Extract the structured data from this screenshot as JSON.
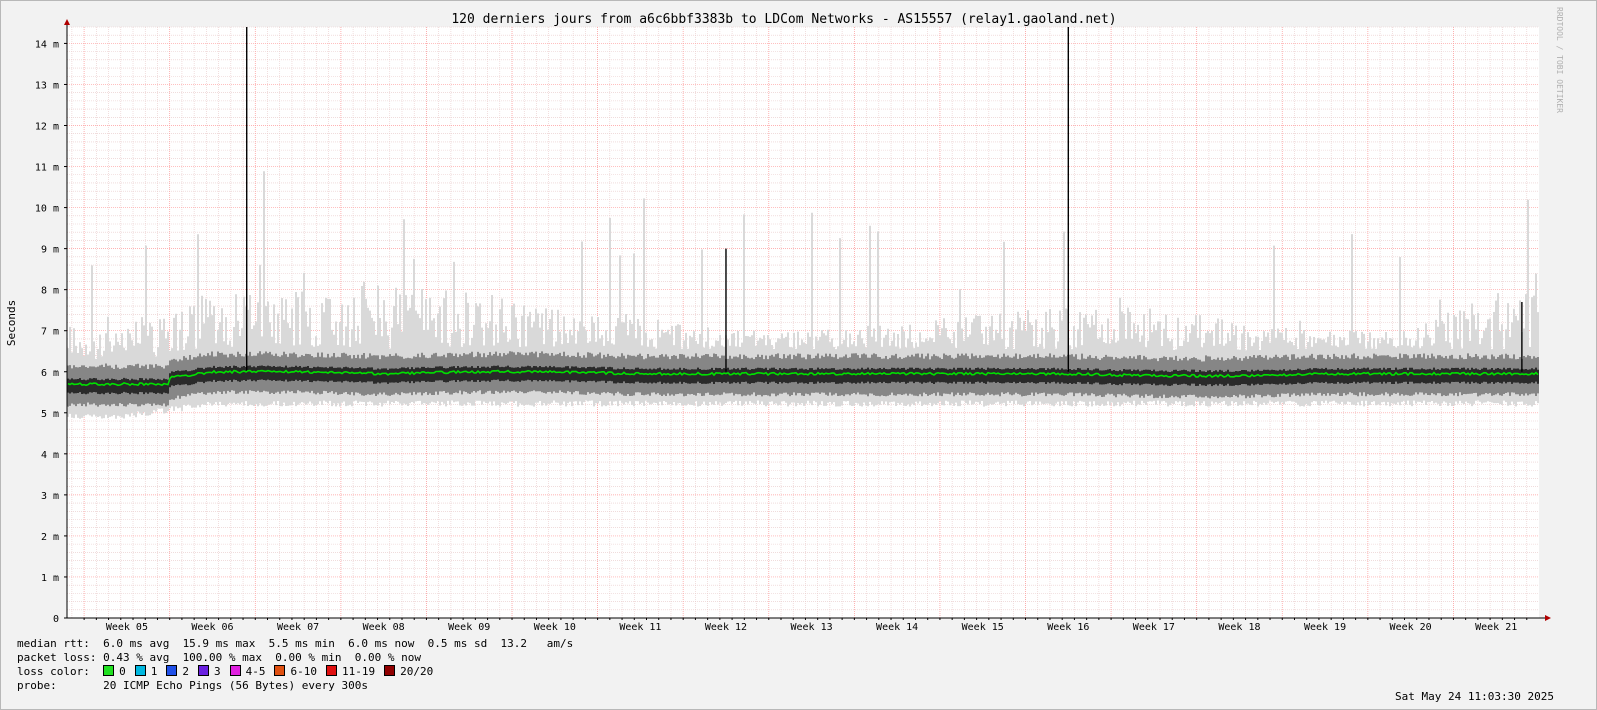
{
  "chart_data": {
    "type": "area",
    "title": "120 derniers jours from a6c6bbf3383b to LDCom Networks - AS15557 (relay1.gaoland.net)",
    "ylabel": "Seconds",
    "watermark": "RRDTOOL / TOBI OETIKER",
    "ylim": [
      0,
      14.4
    ],
    "yticks": [
      {
        "value": 0,
        "label": "0"
      },
      {
        "value": 1,
        "label": "1 m"
      },
      {
        "value": 2,
        "label": "2 m"
      },
      {
        "value": 3,
        "label": "3 m"
      },
      {
        "value": 4,
        "label": "4 m"
      },
      {
        "value": 5,
        "label": "5 m"
      },
      {
        "value": 6,
        "label": "6 m"
      },
      {
        "value": 7,
        "label": "7 m"
      },
      {
        "value": 8,
        "label": "8 m"
      },
      {
        "value": 9,
        "label": "9 m"
      },
      {
        "value": 10,
        "label": "10 m"
      },
      {
        "value": 11,
        "label": "11 m"
      },
      {
        "value": 12,
        "label": "12 m"
      },
      {
        "value": 13,
        "label": "13 m"
      },
      {
        "value": 14,
        "label": "14 m"
      }
    ],
    "categories": [
      "Week 05",
      "Week 06",
      "Week 07",
      "Week 08",
      "Week 09",
      "Week 10",
      "Week 11",
      "Week 12",
      "Week 13",
      "Week 14",
      "Week 15",
      "Week 16",
      "Week 17",
      "Week 18",
      "Week 19",
      "Week 20",
      "Week 21"
    ],
    "median_rtt_ms": [
      5.7,
      6.0,
      6.0,
      5.95,
      6.0,
      6.0,
      5.95,
      5.95,
      5.95,
      5.95,
      5.95,
      5.95,
      5.9,
      5.9,
      5.95,
      5.95,
      5.95
    ],
    "smoke_min_ms": [
      5.0,
      5.3,
      5.3,
      5.3,
      5.3,
      5.3,
      5.3,
      5.3,
      5.3,
      5.3,
      5.3,
      5.3,
      5.3,
      5.3,
      5.3,
      5.3,
      5.3
    ],
    "smoke_max_ms": [
      7.2,
      8.0,
      8.2,
      8.2,
      8.0,
      7.6,
      7.4,
      7.0,
      7.0,
      7.2,
      7.4,
      7.6,
      7.6,
      7.2,
      7.0,
      7.0,
      8.0
    ],
    "spikes_ms": [
      {
        "week_pos": 1.9,
        "value": 14.4
      },
      {
        "week_pos": 7.5,
        "value": 9.0
      },
      {
        "week_pos": 11.5,
        "value": 14.4
      },
      {
        "week_pos": 16.8,
        "value": 7.7
      }
    ],
    "colors": {
      "median": "#00e000",
      "smoke_dark": "#1a1a1a",
      "smoke_light": "#d9d9d9",
      "grid_major": "#ff9a9a",
      "grid_minor": "#e8c8c8",
      "background": "#ffffff",
      "axis": "#000000",
      "arrow": "#b00000"
    }
  },
  "stats": {
    "median_rtt": "median rtt:  6.0 ms avg  15.9 ms max  5.5 ms min  6.0 ms now  0.5 ms sd  13.2   am/s",
    "packet_loss": "packet loss: 0.43 % avg  100.00 % max  0.00 % min  0.00 % now",
    "loss_color_label": "loss color:",
    "probe": "probe:       20 ICMP Echo Pings (56 Bytes) every 300s"
  },
  "loss_colors": [
    {
      "label": "0",
      "color": "#20e020"
    },
    {
      "label": "1",
      "color": "#00b8e0"
    },
    {
      "label": "2",
      "color": "#2050e8"
    },
    {
      "label": "3",
      "color": "#6a20e0"
    },
    {
      "label": "4-5",
      "color": "#e020e0"
    },
    {
      "label": "6-10",
      "color": "#e05010"
    },
    {
      "label": "11-19",
      "color": "#e01010"
    },
    {
      "label": "20/20",
      "color": "#900000"
    }
  ],
  "timestamp": "Sat May 24 11:03:30 2025"
}
